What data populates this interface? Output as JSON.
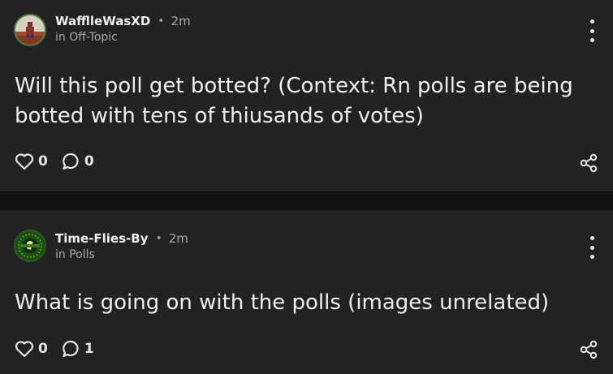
{
  "posts": [
    {
      "author": "WafflleWasXD",
      "separator": "•",
      "time": "2m",
      "community": "in Off-Topic",
      "body": "Will this poll get botted? (Context: Rn polls are being botted with tens of thiusands of votes)",
      "likes": "0",
      "comments": "0",
      "avatar": "avatar-minecraft-character"
    },
    {
      "author": "Time-Flies-By",
      "separator": "•",
      "time": "2m",
      "community": "in Polls",
      "body": "What is going on with the polls (images unrelated)",
      "likes": "0",
      "comments": "1",
      "avatar": "avatar-green-badge"
    }
  ],
  "icons": {
    "like": "heart-outline-icon",
    "comment": "speech-bubble-icon",
    "share": "share-icon",
    "menu": "vertical-ellipsis-icon"
  },
  "colors": {
    "background": "#111111",
    "card": "#222222",
    "text": "#efefef",
    "muted": "#a8a8a8"
  }
}
